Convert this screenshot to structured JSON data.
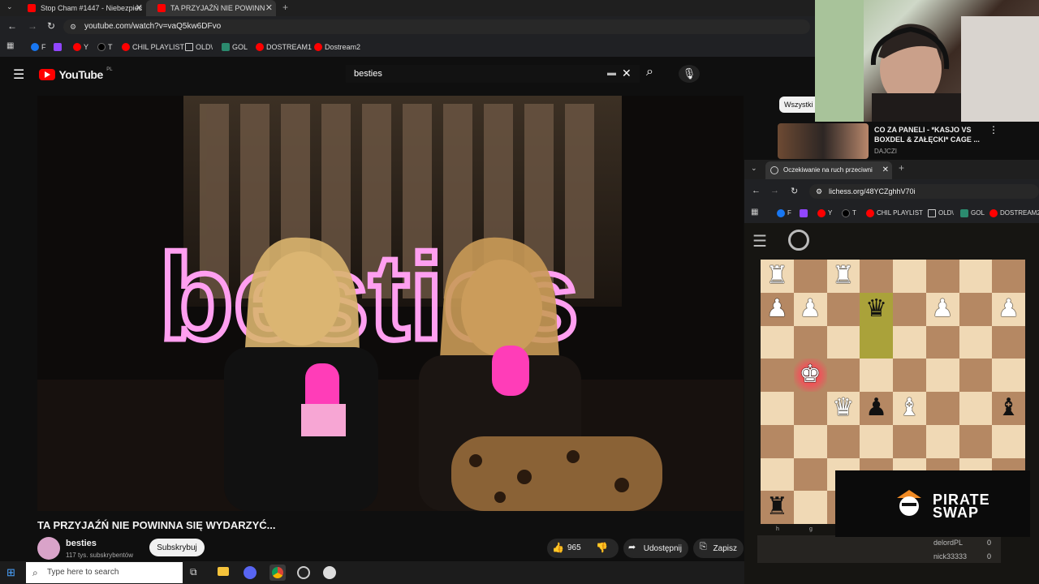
{
  "tabs": [
    {
      "label": "Stop Cham #1447 - Niebezpiec"
    },
    {
      "label": "TA PRZYJAŹŃ NIE POWINN"
    }
  ],
  "address": {
    "url": "youtube.com/watch?v=vaQ5kw6DFvo"
  },
  "bookmarks": [
    "F",
    "",
    "Y",
    "T",
    "CHIL PLAYLIST",
    "OLD\\",
    "GOL",
    "DOSTREAM1",
    "Dostream2"
  ],
  "youtube": {
    "logo": "YouTube",
    "region": "PL",
    "search_value": "besties"
  },
  "video": {
    "title": "TA PRZYJAŹŃ NIE POWINNA SIĘ WYDARZYĆ...",
    "neon_text": "besties"
  },
  "channel": {
    "name": "besties",
    "subs": "117 tys. subskrybentów",
    "subscribe_label": "Subskrybuj"
  },
  "actions": {
    "likes": "965",
    "share_label": "Udostępnij",
    "save_label": "Zapisz"
  },
  "sidebar": {
    "chip": "Wszystki",
    "rec_title": "CO ZA PANELI - *KASJO VS BOXDEL & ZAŁĘCKI* CAGE ...",
    "rec_channel": "DAJCZI"
  },
  "lichess": {
    "tab_label": "Oczekiwanie na ruch przeciwni",
    "url": "lichess.org/48YCZghhV70i",
    "bookmarks": [
      "F",
      "",
      "Y",
      "T",
      "CHIL PLAYLIST",
      "OLD\\",
      "GOL",
      "DOSTREAM2"
    ],
    "file_labels": [
      "h",
      "g"
    ],
    "players": [
      {
        "name": "delordPL",
        "score": "0"
      },
      {
        "name": "nick33333",
        "score": "0"
      }
    ]
  },
  "overlay": {
    "line1": "PIRATE",
    "line2": "SWAP"
  },
  "taskbar": {
    "search_placeholder": "Type here to search"
  },
  "colors": {
    "youtube_red": "#ff0000",
    "board_light": "#f0d9b5",
    "board_dark": "#b58863",
    "neon_pink": "#ff4fd8"
  }
}
